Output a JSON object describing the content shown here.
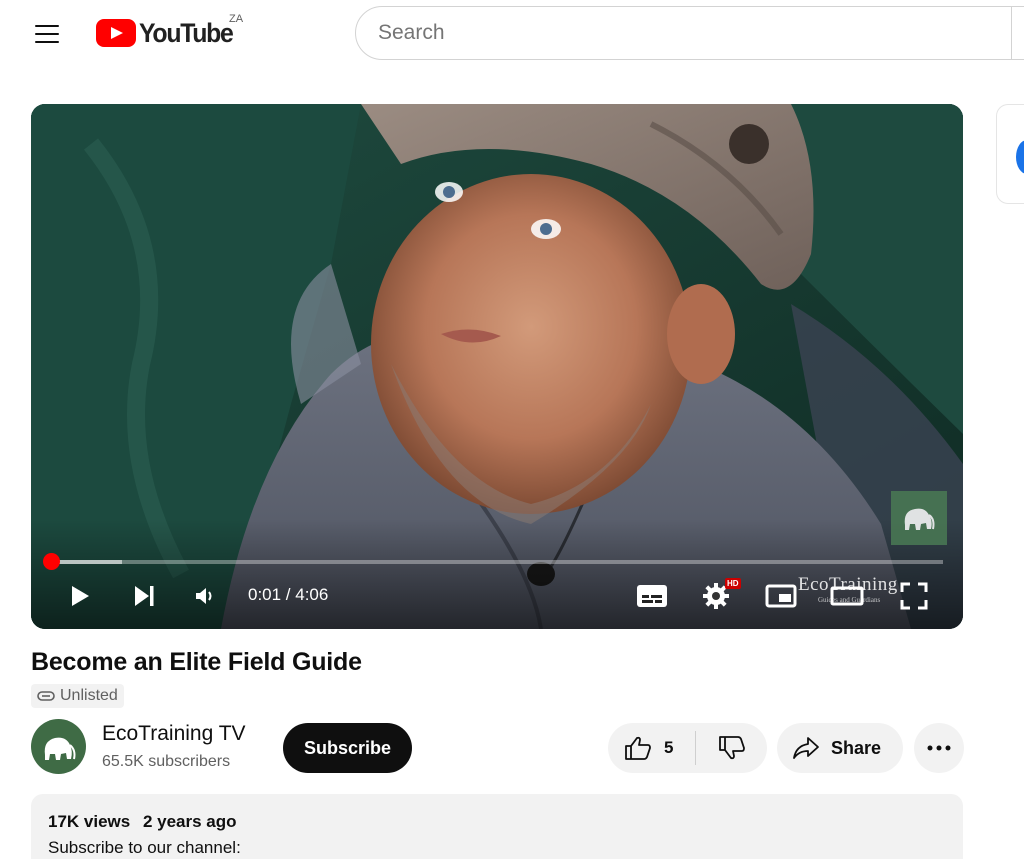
{
  "header": {
    "logo_text": "YouTube",
    "country_code": "ZA",
    "search_placeholder": "Search"
  },
  "player": {
    "current_time": "0:01",
    "duration": "4:06",
    "time_display": "0:01 / 4:06",
    "played_fraction": 0.004,
    "buffered_fraction": 0.08,
    "hd_badge": "HD",
    "brand_overlay": "EcoTraining",
    "brand_tagline": "Guides and Guardians"
  },
  "video": {
    "title": "Become an Elite Field Guide",
    "visibility": "Unlisted"
  },
  "channel": {
    "name": "EcoTraining TV",
    "subscribers": "65.5K subscribers",
    "subscribe_label": "Subscribe"
  },
  "actions": {
    "like_count": "5",
    "share_label": "Share"
  },
  "description": {
    "views": "17K views",
    "age": "2 years ago",
    "first_line": "Subscribe to our channel:"
  },
  "colors": {
    "brand_red": "#ff0000",
    "pill_bg": "#f2f2f2",
    "text_primary": "#0f0f0f",
    "text_secondary": "#606060"
  },
  "icons": [
    "menu-icon",
    "youtube-logo-icon",
    "play-icon",
    "next-icon",
    "volume-icon",
    "subtitles-icon",
    "settings-icon",
    "miniplayer-icon",
    "theater-icon",
    "fullscreen-icon",
    "link-icon",
    "thumbs-up-icon",
    "thumbs-down-icon",
    "share-icon",
    "more-icon"
  ]
}
